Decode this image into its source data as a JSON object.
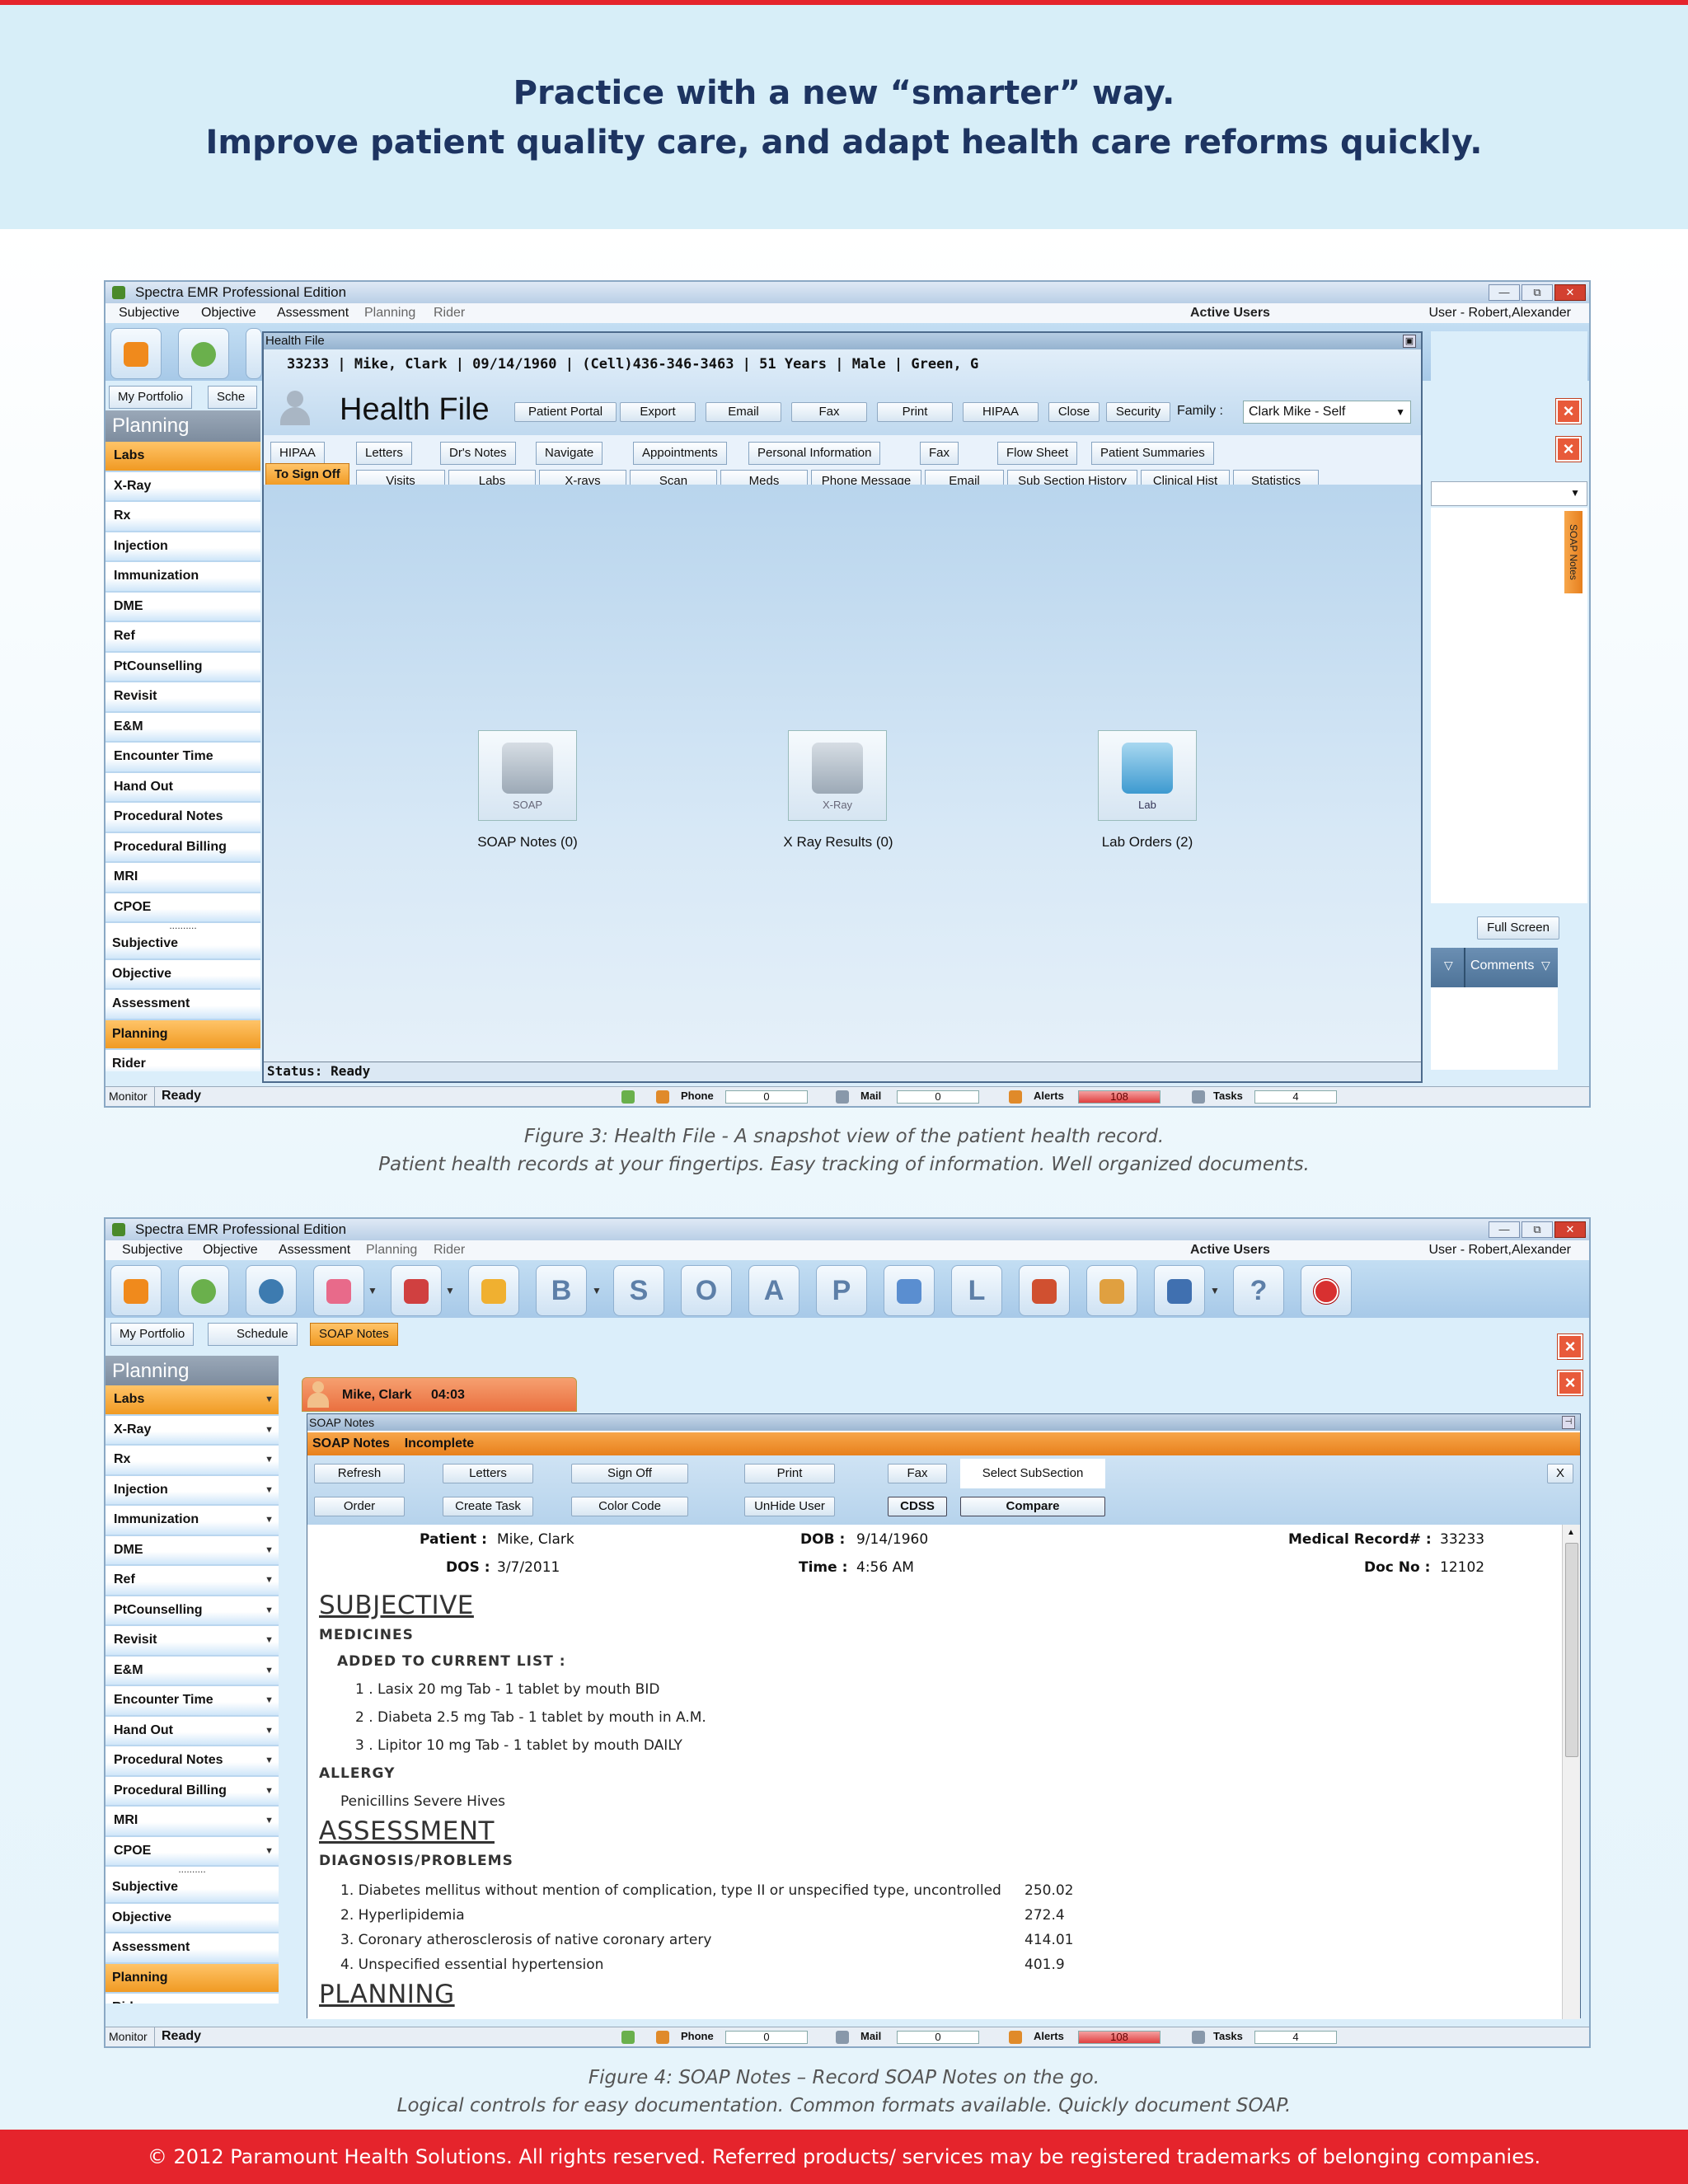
{
  "header": {
    "line1": "Practice with a new “smarter” way.",
    "line2": "Improve patient quality care, and adapt health care reforms quickly."
  },
  "app": {
    "title": "Spectra EMR Professional Edition",
    "menu": [
      "Subjective",
      "Objective",
      "Assessment",
      "Planning",
      "Rider"
    ],
    "active_users": "Active Users",
    "user": "User - Robert,Alexander",
    "window_buttons": [
      "—",
      "⧉",
      "✕"
    ]
  },
  "sidebar": {
    "header": "Planning",
    "items": [
      "Labs",
      "X-Ray",
      "Rx",
      "Injection",
      "Immunization",
      "DME",
      "Ref",
      "PtCounselling",
      "Revisit",
      "E&M",
      "Encounter Time",
      "Hand Out",
      "Procedural Notes",
      "Procedural Billing",
      "MRI",
      "CPOE"
    ],
    "dots": "..........",
    "sections": [
      "Subjective",
      "Objective",
      "Assessment",
      "Planning",
      "Rider"
    ]
  },
  "status": {
    "monitor": "Monitor",
    "ready": "Ready",
    "phone_label": "Phone",
    "phone_value": "0",
    "mail_label": "Mail",
    "mail_value": "0",
    "alerts_label": "Alerts",
    "alerts_value": "108",
    "tasks_label": "Tasks",
    "tasks_value": "4"
  },
  "fig3": {
    "tabs": [
      "My Portfolio",
      "Sche"
    ],
    "dialog_title": "Health File",
    "patient_line": "33233 | Mike, Clark   | 09/14/1960 | (Cell)436-346-3463 | 51 Years  | Male | Green, G",
    "heading": "Health File",
    "buttons": [
      "Patient Portal",
      "Export",
      "Email",
      "Fax",
      "Print",
      "HIPAA",
      "Close",
      "Security"
    ],
    "family_label": "Family :",
    "family_value": "Clark  Mike - Self",
    "tabs_row1": [
      "HIPAA",
      "Letters",
      "Dr's Notes",
      "Navigate",
      "Appointments",
      "Personal Information",
      "Fax",
      "Flow Sheet",
      "Patient Summaries"
    ],
    "tabs_row2": [
      "To Sign Off",
      "Visits",
      "Labs",
      "X-rays",
      "Scan",
      "Meds",
      "Phone Message",
      "Email",
      "Sub Section History",
      "Clinical Hist",
      "Statistics"
    ],
    "tiles": [
      {
        "icon_text": "SOAP",
        "label": "SOAP Notes (0)"
      },
      {
        "icon_text": "X-Ray",
        "label": "X Ray Results (0)"
      },
      {
        "icon_text": "Lab",
        "label": "Lab Orders (2)"
      }
    ],
    "dialog_status": "Status: Ready",
    "soap_notes_vtab": "SOAP Notes",
    "full_screen": "Full Screen",
    "comments": "Comments",
    "caption1": "Figure 3: Health File - A snapshot view of the patient health record.",
    "caption2": "Patient health records at your fingertips. Easy tracking of information. Well organized documents."
  },
  "fig4": {
    "toolbar_letters": [
      "B",
      "S",
      "O",
      "A",
      "P",
      "L",
      "?"
    ],
    "tabs": [
      "My Portfolio",
      "Schedule",
      "SOAP Notes"
    ],
    "patient_tab": "Mike, Clark",
    "patient_time": "04:03",
    "panel_title": "SOAP Notes",
    "soap_status": "SOAP Notes    Incomplete",
    "buttons_row1": [
      "Refresh",
      "Letters",
      "Sign Off",
      "Print",
      "Fax"
    ],
    "select_subsection": "Select SubSection",
    "buttons_row2": [
      "Order",
      "Create Task",
      "Color Code",
      "UnHide User",
      "CDSS",
      "Compare"
    ],
    "close_x": "X",
    "patient_label": "Patient :",
    "patient_name": "Mike, Clark",
    "dob_label": "DOB :",
    "dob_value": "9/14/1960",
    "mrn_label": "Medical Record# :",
    "mrn_value": "33233",
    "dos_label": "DOS :",
    "dos_value": "3/7/2011",
    "time_label": "Time :",
    "time_value": "4:56 AM",
    "docno_label": "Doc No :",
    "docno_value": "12102",
    "subjective": "SUBJECTIVE",
    "medicines": "MEDICINES",
    "added": "ADDED TO CURRENT LIST :",
    "meds": [
      "1 . Lasix 20 mg Tab - 1 tablet by mouth BID",
      "2 . Diabeta 2.5 mg Tab - 1 tablet by mouth in A.M.",
      "3 . Lipitor 10 mg Tab - 1 tablet by mouth DAILY"
    ],
    "allergy": "ALLERGY",
    "allergy_value": "Penicillins Severe Hives",
    "assessment": "ASSESSMENT",
    "diagnosis": "DIAGNOSIS/PROBLEMS",
    "problems": [
      {
        "text": "1. Diabetes mellitus without mention of complication, type II or unspecified type, uncontrolled",
        "code": "250.02"
      },
      {
        "text": "2. Hyperlipidemia",
        "code": "272.4"
      },
      {
        "text": "3. Coronary atherosclerosis of native coronary artery",
        "code": "414.01"
      },
      {
        "text": "4. Unspecified essential hypertension",
        "code": "401.9"
      }
    ],
    "planning": "PLANNING",
    "caption1": "Figure 4: SOAP Notes – Record SOAP Notes on the go.",
    "caption2": "Logical controls for easy documentation. Common formats available. Quickly document SOAP."
  },
  "footer": "© 2012 Paramount Health Solutions. All rights reserved. Referred products/ services may be registered trademarks of belonging companies."
}
